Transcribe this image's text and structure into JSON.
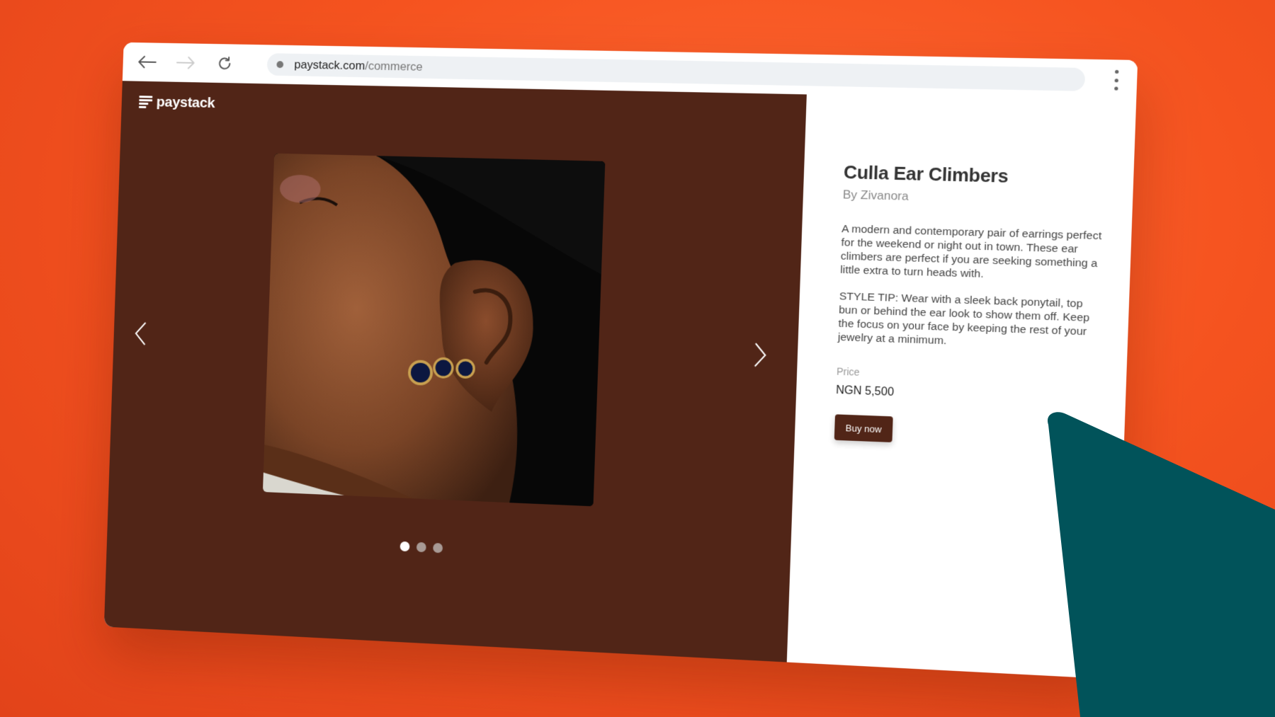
{
  "browser": {
    "url_host": "paystack.com",
    "url_path": "/commerce",
    "icons": {
      "back": "back-arrow-icon",
      "forward": "forward-arrow-icon",
      "reload": "reload-icon",
      "menu": "more-vertical-icon"
    }
  },
  "store": {
    "logo_text": "paystack",
    "carousel": {
      "active_index": 0,
      "slide_count": 3
    }
  },
  "product": {
    "title": "Culla Ear Climbers",
    "brand": "By Zivanora",
    "description": "A modern and contemporary pair of earrings perfect for the weekend or night out in town. These ear climbers are perfect if you are seeking something a little extra to turn heads with.",
    "style_tip": "STYLE TIP: Wear with a sleek back ponytail, top bun or behind the ear look to show them off. Keep the focus on your face by keeping the rest of your jewelry at a minimum.",
    "price_label": "Price",
    "price": "NGN 5,500",
    "buy_label": "Buy now"
  },
  "colors": {
    "background": "#f5531f",
    "store_brown": "#512517",
    "accent_teal": "#01535a"
  }
}
